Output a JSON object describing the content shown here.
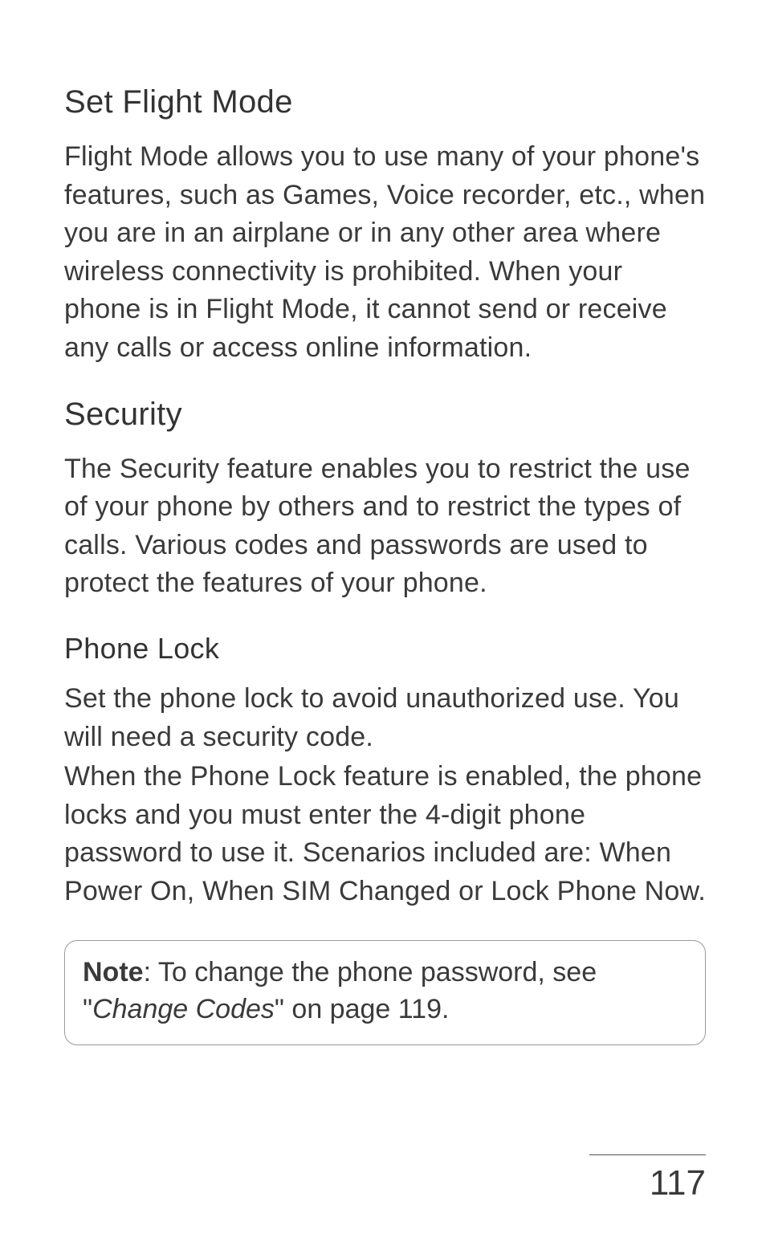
{
  "sections": {
    "flight_mode": {
      "heading": "Set Flight Mode",
      "body": "Flight Mode allows you to use many of your phone's features, such as Games, Voice recorder, etc., when you are in an airplane or in any other area where wireless connectivity is prohibited. When your phone is in Flight Mode, it cannot send or receive any calls or access online information."
    },
    "security": {
      "heading": "Security",
      "body": "The Security feature enables you to restrict the use of your phone by others and to restrict the types of calls. Various codes and passwords are used to protect the features of your phone."
    },
    "phone_lock": {
      "heading": "Phone Lock",
      "body1": "Set the phone lock to avoid unauthorized use. You will need a security code.",
      "body2": "When the Phone Lock feature is enabled, the phone locks and you must enter the 4-digit phone password to use it. Scenarios included are: When Power On, When SIM Changed or Lock Phone Now."
    },
    "note": {
      "label": "Note",
      "text1": ": To change the phone password, see \"",
      "ref": "Change Codes",
      "text2": "\" on page 119."
    }
  },
  "page_number": "117"
}
